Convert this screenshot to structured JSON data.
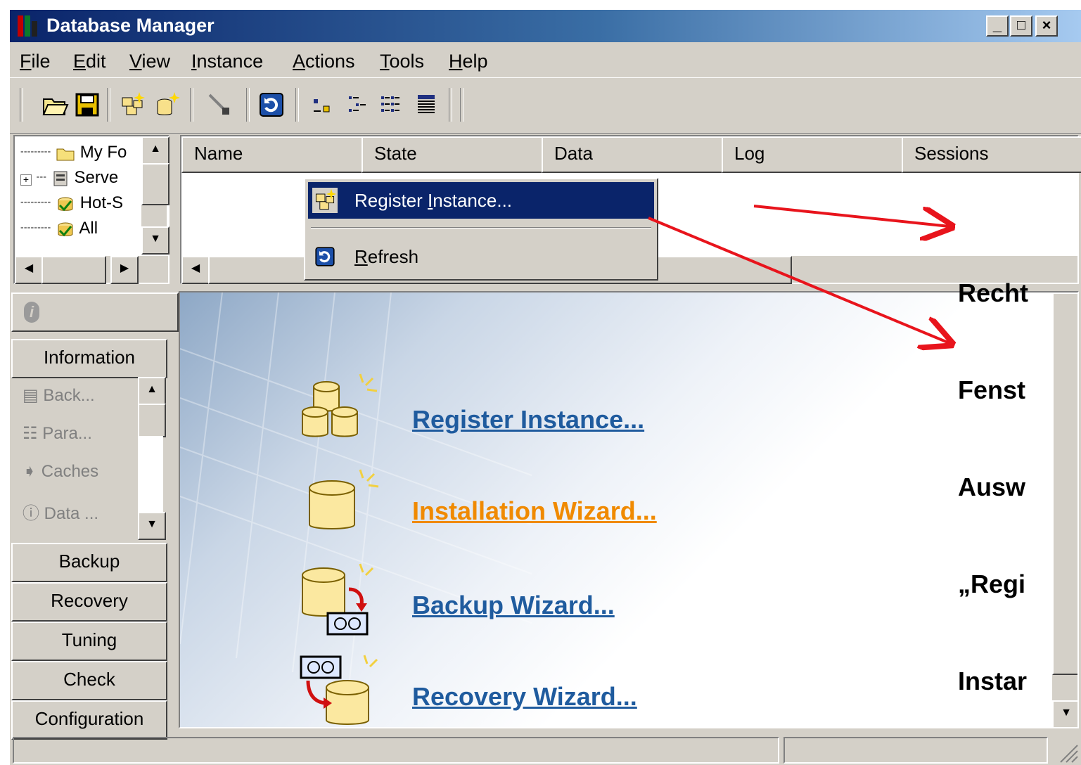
{
  "window": {
    "title": "Database Manager",
    "controls": {
      "minimize": "_",
      "maximize": "□",
      "close": "×"
    }
  },
  "menubar": {
    "items": [
      {
        "accel": "F",
        "rest": "ile"
      },
      {
        "accel": "E",
        "rest": "dit"
      },
      {
        "accel": "V",
        "rest": "iew"
      },
      {
        "accel": "I",
        "rest": "nstance"
      },
      {
        "accel": "A",
        "rest": "ctions"
      },
      {
        "accel": "T",
        "rest": "ools"
      },
      {
        "accel": "H",
        "rest": "elp"
      }
    ]
  },
  "toolbar": {
    "icons": [
      "open-icon",
      "save-icon",
      "register-instance-icon",
      "create-database-icon",
      "disconnect-icon",
      "refresh-icon",
      "small-icons-view-icon",
      "list-view-icon",
      "details-view-icon",
      "report-view-icon"
    ]
  },
  "tree": {
    "items": [
      "My Fo",
      "Serve",
      "Hot-S",
      "All"
    ],
    "expander": "+"
  },
  "list": {
    "columns": [
      "Name",
      "State",
      "Data",
      "Log",
      "Sessions"
    ]
  },
  "context_menu": {
    "items": [
      {
        "before": "Register ",
        "accel": "I",
        "after": "nstance...",
        "highlighted": true
      },
      {
        "before": "",
        "accel": "R",
        "after": "efresh",
        "highlighted": false
      }
    ]
  },
  "nav": {
    "info_glyph": "i",
    "information": "Information",
    "sub_items": [
      "Back...",
      "Para...",
      "Caches",
      "Data ..."
    ],
    "buttons": [
      "Backup",
      "Recovery",
      "Tuning",
      "Check",
      "Configuration"
    ]
  },
  "content": {
    "links": [
      {
        "label": "Register Instance...",
        "color": "#1f5b9e"
      },
      {
        "label": "Installation Wizard...",
        "color": "#f08a00"
      },
      {
        "label": "Backup Wizard...",
        "color": "#1f5b9e"
      },
      {
        "label": "Recovery Wizard...",
        "color": "#1f5b9e"
      }
    ]
  },
  "annotation": {
    "lines": [
      "Recht",
      "Fenst",
      "Ausw",
      "„Regi",
      "Instar"
    ],
    "arrow_color": "#e8141c"
  }
}
